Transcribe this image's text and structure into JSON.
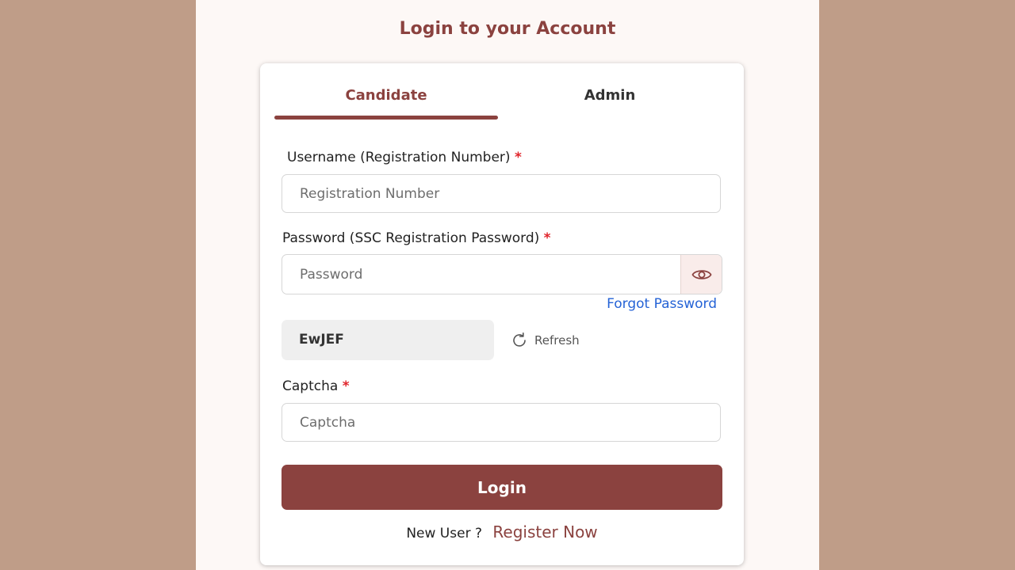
{
  "page": {
    "title": "Login to your Account"
  },
  "tabs": {
    "candidate": "Candidate",
    "admin": "Admin",
    "active": "Candidate"
  },
  "form": {
    "username": {
      "label": "Username (Registration Number)",
      "required_mark": "*",
      "placeholder": "Registration Number",
      "value": ""
    },
    "password": {
      "label": "Password (SSC Registration Password)",
      "required_mark": "*",
      "placeholder": "Password",
      "value": "",
      "toggle_icon": "eye-icon"
    },
    "forgot_password": "Forgot Password",
    "captcha_code": "EwJEF",
    "refresh_label": "Refresh",
    "refresh_icon": "refresh-icon",
    "captcha": {
      "label": "Captcha",
      "required_mark": "*",
      "placeholder": "Captcha",
      "value": ""
    },
    "login_label": "Login"
  },
  "footer": {
    "new_user_text": "New User ?",
    "register_label": "Register Now"
  },
  "colors": {
    "background": "#bf9d88",
    "panel": "#fdf8f6",
    "brand": "#8b423f",
    "link": "#2563d6",
    "required": "#e0242b"
  }
}
